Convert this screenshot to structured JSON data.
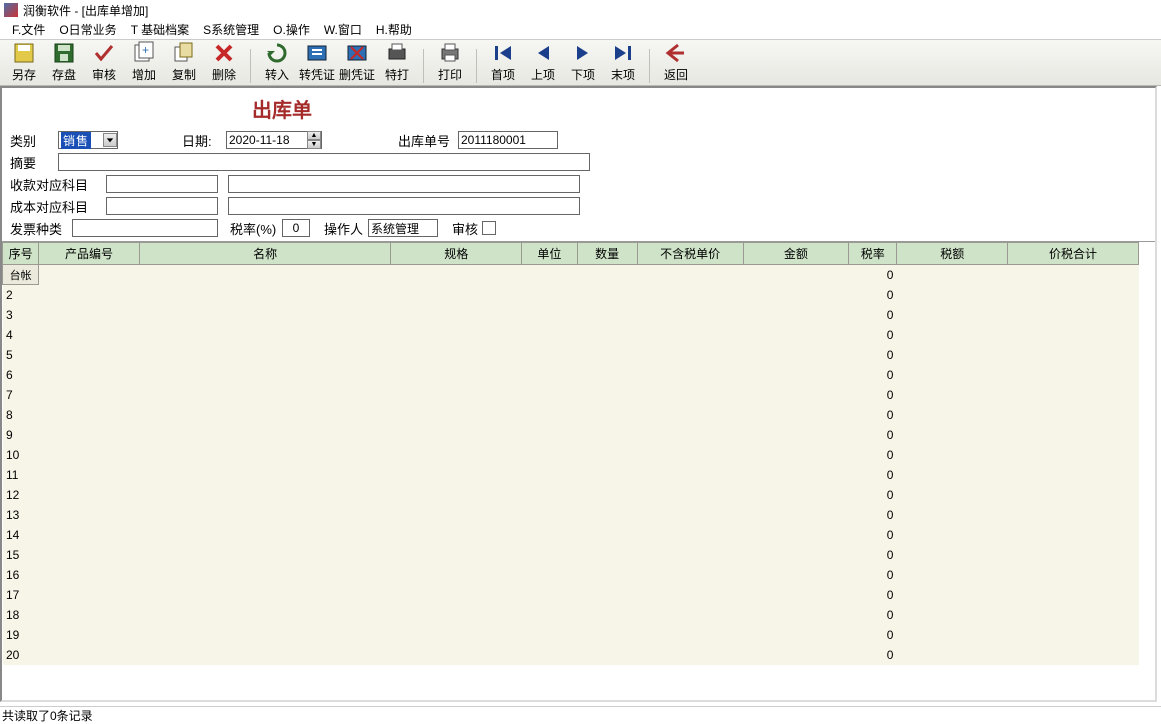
{
  "window": {
    "title": "润衡软件 - [出库单增加]"
  },
  "menu": {
    "file": "F.文件",
    "daily": "O日常业务",
    "base": "T 基础档案",
    "sys": "S系统管理",
    "op": "O.操作",
    "win": "W.窗口",
    "help": "H.帮助"
  },
  "toolbar": {
    "save_as": "另存",
    "save": "存盘",
    "audit": "审核",
    "add": "增加",
    "copy": "复制",
    "delete": "删除",
    "import": "转入",
    "voucher": "转凭证",
    "del_voucher": "删凭证",
    "special_print": "特打",
    "print": "打印",
    "first": "首项",
    "prev": "上项",
    "next": "下项",
    "last": "末项",
    "back": "返回"
  },
  "doc": {
    "title": "出库单",
    "category_label": "类别",
    "category_value": "销售",
    "date_label": "日期:",
    "date_value": "2020-11-18",
    "docno_label": "出库单号",
    "docno_value": "2011180001",
    "summary_label": "摘要",
    "summary_value": "",
    "recv_subject_label": "收款对应科目",
    "recv_subject_code": "",
    "recv_subject_name": "",
    "cost_subject_label": "成本对应科目",
    "cost_subject_code": "",
    "cost_subject_name": "",
    "invoice_label": "发票种类",
    "invoice_value": "",
    "taxrate_label": "税率(%)",
    "taxrate_value": "0",
    "operator_label": "操作人",
    "operator_value": "系统管理",
    "audit_chk_label": "审核"
  },
  "grid": {
    "headers": {
      "seq": "序号",
      "prod_code": "产品编号",
      "name": "名称",
      "spec": "规格",
      "unit": "单位",
      "qty": "数量",
      "price_excl": "不含税单价",
      "amount": "金额",
      "taxrate": "税率",
      "tax": "税额",
      "total": "价税合计"
    },
    "rowhdr_first": "台帐",
    "rows": [
      {
        "taxrate": "0"
      },
      {
        "taxrate": "0"
      },
      {
        "taxrate": "0"
      },
      {
        "taxrate": "0"
      },
      {
        "taxrate": "0"
      },
      {
        "taxrate": "0"
      },
      {
        "taxrate": "0"
      },
      {
        "taxrate": "0"
      },
      {
        "taxrate": "0"
      },
      {
        "taxrate": "0"
      },
      {
        "taxrate": "0"
      },
      {
        "taxrate": "0"
      },
      {
        "taxrate": "0"
      },
      {
        "taxrate": "0"
      },
      {
        "taxrate": "0"
      },
      {
        "taxrate": "0"
      },
      {
        "taxrate": "0"
      },
      {
        "taxrate": "0"
      },
      {
        "taxrate": "0"
      },
      {
        "taxrate": "0"
      }
    ]
  },
  "status": {
    "text": "共读取了0条记录"
  }
}
